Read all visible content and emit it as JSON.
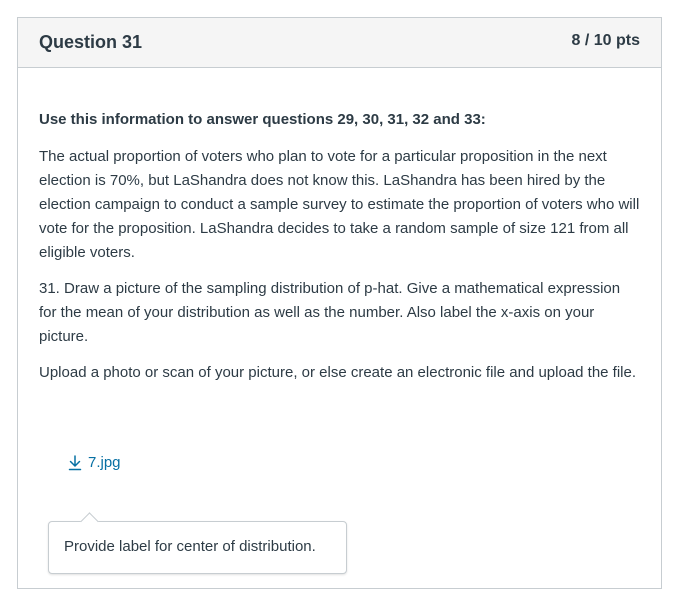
{
  "question": {
    "title": "Question 31",
    "points": "8 / 10 pts"
  },
  "body": {
    "intro": "Use this information to answer questions 29, 30, 31, 32 and 33:",
    "context": "The actual proportion of voters who plan to vote for a particular proposition in the next election is 70%, but LaShandra does not know this.  LaShandra has been hired by the election campaign to conduct a sample survey to estimate the proportion of voters who will vote for the proposition.  LaShandra decides to take a random sample of size 121 from all eligible voters.",
    "prompt": "31.  Draw a picture of the sampling distribution of p-hat.  Give a mathematical expression for the mean of your distribution as well as the number.  Also label the x-axis on your picture.",
    "instructions": "Upload a photo or scan of your picture, or else create an electronic file and upload the file."
  },
  "attachment": {
    "icon": "download-icon",
    "filename": "7.jpg"
  },
  "comment": {
    "text": "Provide label for center of distribution."
  },
  "colors": {
    "link": "#0770a3",
    "text": "#2d3b45",
    "header_bg": "#f5f5f5",
    "border": "#c7cdd1"
  }
}
